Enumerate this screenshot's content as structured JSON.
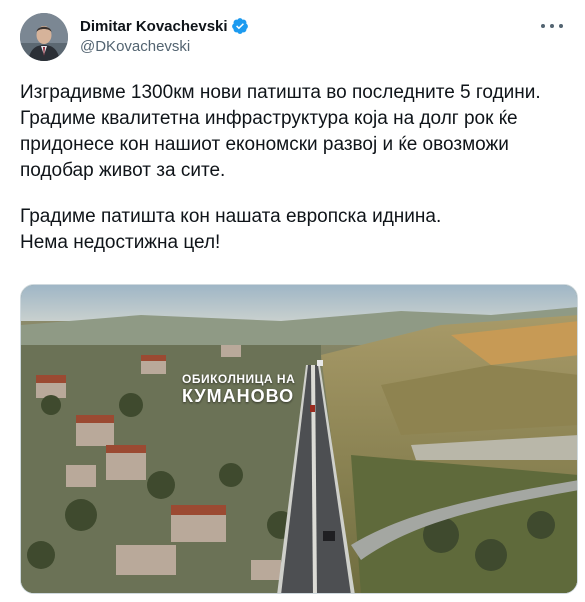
{
  "author": {
    "display_name": "Dimitar Kovachevski",
    "handle": "@DKovachevski",
    "verified": true
  },
  "tweet": {
    "paragraph1": "Изградивме 1300км нови патишта во последните 5 години. Градиме квалитетна инфраструктура која на долг рок ќе придонесе кон нашиот економски развој и ќе овозможи подобар живот за сите.",
    "paragraph2": "Градиме патишта кон нашата европска иднина.\nНема недостижна цел!"
  },
  "media": {
    "overlay_line1": "ОБИКОЛНИЦА НА",
    "overlay_line2": "КУМАНОВО"
  },
  "icons": {
    "verified": "verified-badge-icon",
    "more": "more-options-icon"
  },
  "colors": {
    "verified_blue": "#1d9bf0",
    "text_primary": "#0f1419",
    "text_secondary": "#536471"
  }
}
